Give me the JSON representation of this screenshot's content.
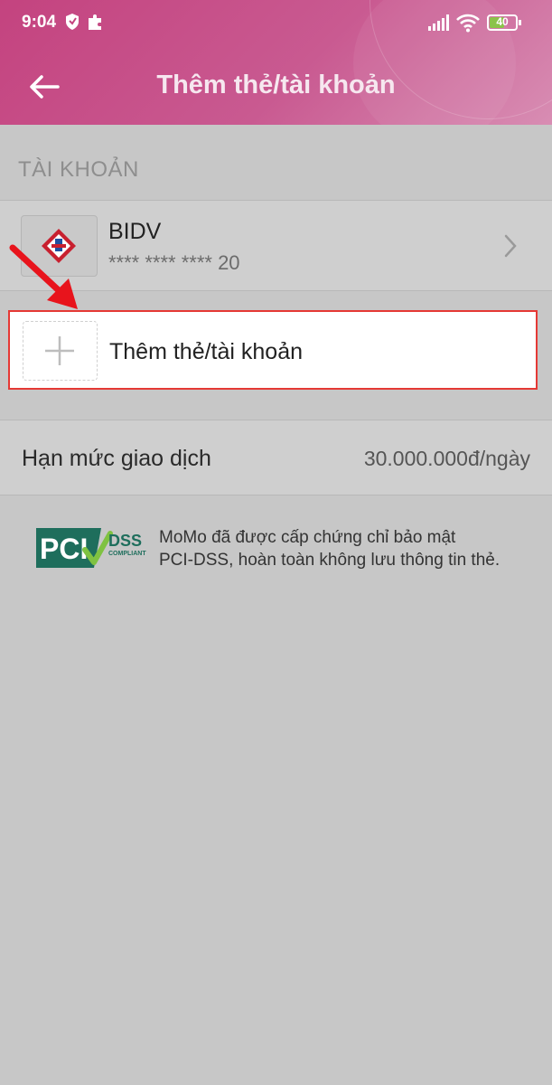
{
  "status_bar": {
    "time": "9:04",
    "battery": "40"
  },
  "nav": {
    "title": "Thêm thẻ/tài khoản"
  },
  "section": {
    "label": "TÀI KHOẢN"
  },
  "account": {
    "bank_name": "BIDV",
    "masked_number": "**** **** **** 20"
  },
  "add_account": {
    "label": "Thêm thẻ/tài khoản"
  },
  "limit": {
    "label": "Hạn mức giao dịch",
    "value": "30.000.000đ/ngày"
  },
  "pci": {
    "logo_text": "PCI",
    "logo_dss": "DSS",
    "logo_compliant": "COMPLIANT",
    "line1": "MoMo đã được cấp chứng chỉ bảo mật",
    "line2": "PCI-DSS, hoàn toàn không lưu thông tin thẻ."
  },
  "colors": {
    "header_accent": "#c4437f",
    "highlight_border": "#e53935",
    "background": "#c7c7c7"
  },
  "icons": [
    "back-arrow-icon",
    "shield-icon",
    "puzzle-icon",
    "signal-icon",
    "wifi-icon",
    "battery-icon",
    "bidv-logo-icon",
    "chevron-right-icon",
    "plus-icon",
    "annotation-arrow-icon"
  ]
}
